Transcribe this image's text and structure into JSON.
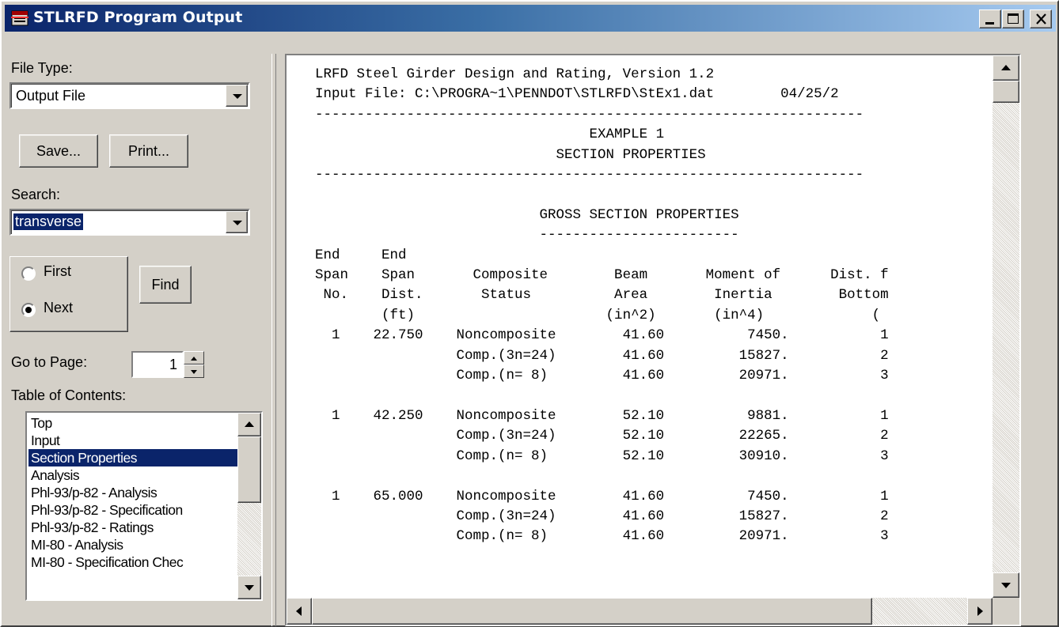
{
  "window": {
    "title": "STLRFD Program Output"
  },
  "left": {
    "file_type_label": "File Type:",
    "file_type_value": "Output File",
    "save_label": "Save...",
    "print_label": "Print...",
    "search_label": "Search:",
    "search_value": "transverse",
    "radio_first_label": "First",
    "radio_next_label": "Next",
    "radio_selected": "Next",
    "find_label": "Find",
    "goto_label": "Go to Page:",
    "goto_value": "1",
    "toc_label": "Table of Contents:",
    "toc_items": [
      "Top",
      "Input",
      "Section Properties",
      "Analysis",
      "Phl-93/p-82 - Analysis",
      "Phl-93/p-82 - Specification",
      "Phl-93/p-82 - Ratings",
      "MI-80 - Analysis",
      "MI-80 - Specification Chec"
    ],
    "toc_selected_index": 2
  },
  "output": {
    "lines": [
      "LRFD Steel Girder Design and Rating, Version 1.2",
      "Input File: C:\\PROGRA~1\\PENNDOT\\STLRFD\\StEx1.dat        04/25/2",
      "------------------------------------------------------------------",
      "                                 EXAMPLE 1",
      "                             SECTION PROPERTIES",
      "------------------------------------------------------------------",
      "",
      "                           GROSS SECTION PROPERTIES",
      "                           ------------------------",
      "End     End",
      "Span    Span       Composite        Beam       Moment of      Dist. f",
      " No.    Dist.       Status          Area        Inertia        Bottom",
      "        (ft)                       (in^2)       (in^4)             (",
      "  1    22.750    Noncomposite        41.60          7450.           1",
      "                 Comp.(3n=24)        41.60         15827.           2",
      "                 Comp.(n= 8)         41.60         20971.           3",
      "",
      "  1    42.250    Noncomposite        52.10          9881.           1",
      "                 Comp.(3n=24)        52.10         22265.           2",
      "                 Comp.(n= 8)         52.10         30910.           3",
      "",
      "  1    65.000    Noncomposite        41.60          7450.           1",
      "                 Comp.(3n=24)        41.60         15827.           2",
      "                 Comp.(n= 8)         41.60         20971.           3"
    ]
  },
  "icons": {
    "app": "app-window-icon",
    "minimize": "minimize-icon",
    "maximize": "maximize-icon",
    "close": "close-icon",
    "dropdown": "chevron-down-icon",
    "scroll_up": "arrow-up-icon",
    "scroll_down": "arrow-down-icon",
    "scroll_left": "arrow-left-icon",
    "scroll_right": "arrow-right-icon"
  },
  "colors": {
    "title_start": "#0a246a",
    "title_end": "#a6caf0",
    "face": "#d4d0c8",
    "selection": "#0a246a"
  }
}
